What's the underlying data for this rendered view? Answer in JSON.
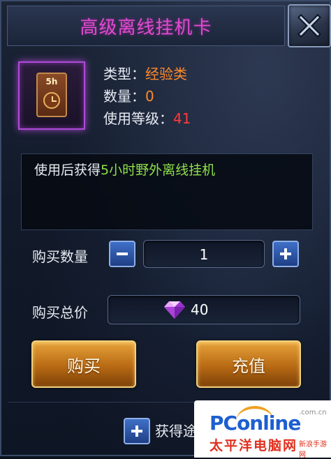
{
  "dialog": {
    "title": "高级离线挂机卡",
    "item_icon_label": "5h",
    "type_label": "类型：",
    "type_value": "经验类",
    "quantity_label": "数量：",
    "quantity_value": "0",
    "level_label": "使用等级：",
    "level_value": "41",
    "description_prefix": "使用后获得",
    "description_highlight": "5小时野外离线挂机",
    "buy_qty_label": "购买数量",
    "buy_qty_value": "1",
    "buy_total_label": "购买总价",
    "buy_total_value": "40",
    "buy_button": "购买",
    "recharge_button": "充值",
    "acquire_label": "获得途"
  },
  "watermark": {
    "brand": "PConline",
    "domain": ".com.cn",
    "cn_name": "太平洋电脑网",
    "stamp": "新浪手游网"
  },
  "icons": {
    "close": "close-x-icon",
    "minus": "minus-icon",
    "plus": "plus-icon",
    "gem": "purple-diamond-icon"
  },
  "colors": {
    "title": "#e04ad0",
    "value_orange": "#ff8a2a",
    "value_red": "#ff3a3a",
    "highlight_green": "#8fe04a",
    "gold_button": "#e7a33a"
  }
}
